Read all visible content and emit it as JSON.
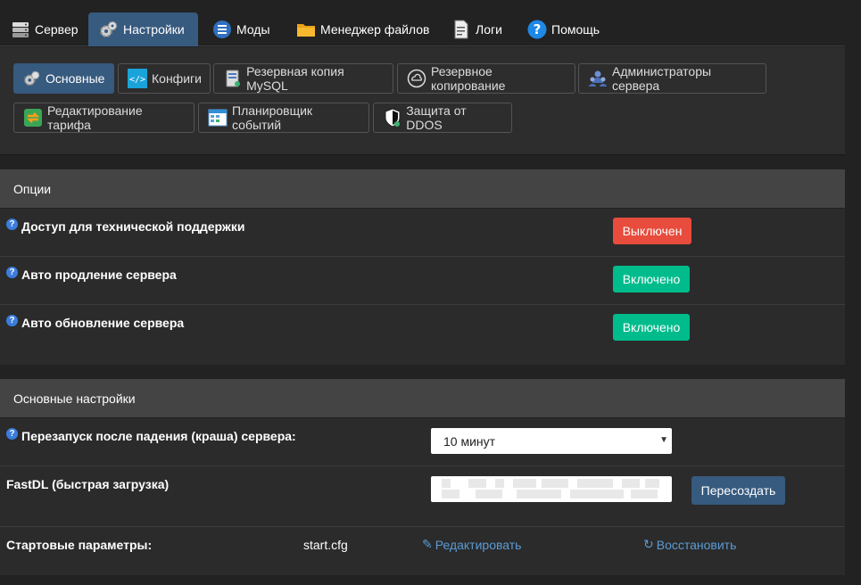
{
  "topnav": {
    "tabs": [
      {
        "label": "Сервер",
        "icon": "server-icon"
      },
      {
        "label": "Настройки",
        "icon": "gears-icon",
        "active": true
      },
      {
        "label": "Моды",
        "icon": "mods-list-icon"
      },
      {
        "label": "Менеджер файлов",
        "icon": "folder-icon"
      },
      {
        "label": "Логи",
        "icon": "log-file-icon"
      },
      {
        "label": "Помощь",
        "icon": "help-icon"
      }
    ]
  },
  "subnav": {
    "items": [
      {
        "label": "Основные",
        "active": true
      },
      {
        "label": "Конфиги"
      },
      {
        "label": "Резервная копия MySQL"
      },
      {
        "label": "Резервное копирование"
      },
      {
        "label": "Администраторы сервера"
      },
      {
        "label": "Редактирование тарифа"
      },
      {
        "label": "Планировщик событий"
      },
      {
        "label": "Защита от DDOS"
      }
    ]
  },
  "options": {
    "header": "Опции",
    "rows": [
      {
        "label": "Доступ для технической поддержки",
        "button": "Выключен",
        "state": "off"
      },
      {
        "label": "Авто продление сервера",
        "button": "Включено",
        "state": "on"
      },
      {
        "label": "Авто обновление сервера",
        "button": "Включено",
        "state": "on"
      }
    ]
  },
  "main_settings": {
    "header": "Основные настройки",
    "restart": {
      "label": "Перезапуск после падения (краша) сервера:",
      "value": "10 минут"
    },
    "fastdl": {
      "label": "FastDL (быстрая загрузка)",
      "button": "Пересоздать"
    },
    "startup": {
      "label": "Стартовые параметры:",
      "file": "start.cfg",
      "edit": "Редактировать",
      "restore": "Восстановить"
    }
  },
  "colors": {
    "accent": "#375a7f",
    "on": "#00bc8c",
    "off": "#e74c3c",
    "link": "#5b9bd5"
  }
}
